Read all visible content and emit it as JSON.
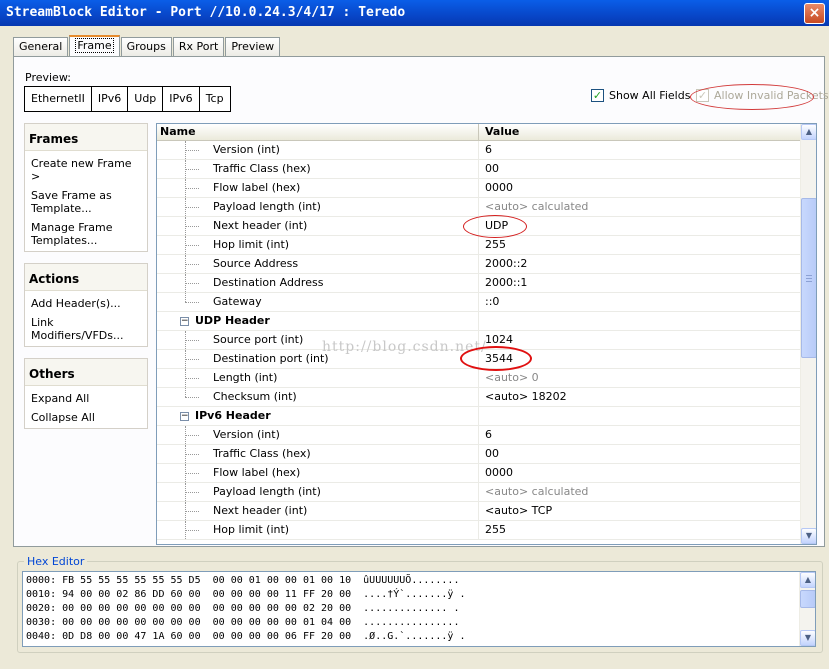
{
  "window": {
    "title": "StreamBlock Editor - Port //10.0.24.3/4/17 : Teredo",
    "close": "×"
  },
  "tabs": [
    "General",
    "Frame",
    "Groups",
    "Rx Port",
    "Preview"
  ],
  "preview": {
    "label": "Preview:",
    "packets": [
      "EthernetII",
      "IPv6",
      "Udp",
      "IPv6",
      "Tcp"
    ]
  },
  "options": {
    "show_all_fields": "Show All Fields",
    "allow_invalid_packets": "Allow Invalid Packets"
  },
  "sidebar": {
    "frames": {
      "title": "Frames",
      "items": [
        "Create new Frame >",
        "Save Frame as Template...",
        "Manage Frame Templates..."
      ]
    },
    "actions": {
      "title": "Actions",
      "items": [
        "Add Header(s)...",
        "Link Modifiers/VFDs..."
      ]
    },
    "others": {
      "title": "Others",
      "items": [
        "Expand All",
        "Collapse All"
      ]
    }
  },
  "grid": {
    "headers": {
      "name": "Name",
      "value": "Value"
    },
    "rows": [
      {
        "name": "Version (int)",
        "value": "6"
      },
      {
        "name": "Traffic Class (hex)",
        "value": "00"
      },
      {
        "name": "Flow label (hex)",
        "value": "0000"
      },
      {
        "name": "Payload length (int)",
        "value": "<auto> calculated"
      },
      {
        "name": "Next header (int)",
        "value": "UDP"
      },
      {
        "name": "Hop limit (int)",
        "value": "255"
      },
      {
        "name": "Source Address",
        "value": "2000::2"
      },
      {
        "name": "Destination Address",
        "value": "2000::1"
      },
      {
        "name": "Gateway",
        "value": "::0"
      },
      {
        "name": "UDP Header",
        "value": ""
      },
      {
        "name": "Source port (int)",
        "value": "1024"
      },
      {
        "name": "Destination port (int)",
        "value": "3544"
      },
      {
        "name": "Length (int)",
        "value": "<auto> 0"
      },
      {
        "name": "Checksum (int)",
        "value": "<auto> 18202"
      },
      {
        "name": "IPv6 Header",
        "value": ""
      },
      {
        "name": "Version (int)",
        "value": "6"
      },
      {
        "name": "Traffic Class (hex)",
        "value": "00"
      },
      {
        "name": "Flow label (hex)",
        "value": "0000"
      },
      {
        "name": "Payload length (int)",
        "value": "<auto> calculated"
      },
      {
        "name": "Next header (int)",
        "value": "<auto> TCP"
      },
      {
        "name": "Hop limit (int)",
        "value": "255"
      }
    ]
  },
  "hex_editor": {
    "label": "Hex Editor",
    "lines": [
      "0000: FB 55 55 55 55 55 55 D5  00 00 01 00 00 01 00 10  ûUUUUUUÕ........",
      "0010: 94 00 00 02 86 DD 60 00  00 00 00 00 11 FF 20 00  ....†Ý`.......ÿ .",
      "0020: 00 00 00 00 00 00 00 00  00 00 00 00 00 02 20 00  .............. .",
      "0030: 00 00 00 00 00 00 00 00  00 00 00 00 00 01 04 00  ................",
      "0040: 0D D8 00 00 47 1A 60 00  00 00 00 00 06 FF 20 00  .Ø..G.`.......ÿ ."
    ]
  },
  "watermark": "http://blog.csdn.net/"
}
